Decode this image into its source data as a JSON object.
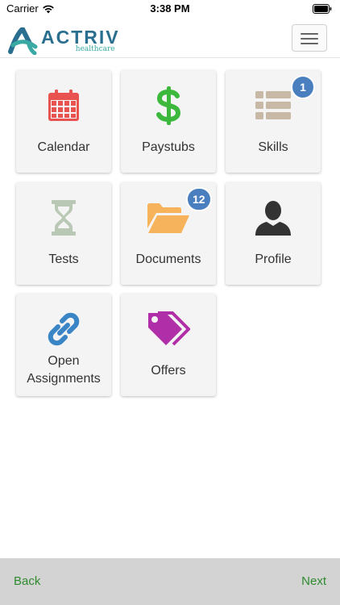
{
  "status": {
    "carrier": "Carrier",
    "time": "3:38 PM"
  },
  "brand": {
    "name": "ACTRIV",
    "sub": "healthcare"
  },
  "tiles": [
    {
      "label": "Calendar",
      "icon": "calendar-icon",
      "color": "#e8534f"
    },
    {
      "label": "Paystubs",
      "icon": "dollar-icon",
      "color": "#3cb83c"
    },
    {
      "label": "Skills",
      "icon": "list-icon",
      "color": "#c8b9a6",
      "badge": "1"
    },
    {
      "label": "Tests",
      "icon": "hourglass-icon",
      "color": "#b8c8b4"
    },
    {
      "label": "Documents",
      "icon": "folder-open-icon",
      "color": "#f7b35c",
      "badge": "12"
    },
    {
      "label": "Profile",
      "icon": "user-icon",
      "color": "#333333"
    },
    {
      "label_line1": "Open",
      "label_line2": "Assignments",
      "icon": "link-icon",
      "color": "#3a85c6"
    },
    {
      "label": "Offers",
      "icon": "tags-icon",
      "color": "#b02fa8"
    }
  ],
  "footer": {
    "back": "Back",
    "next": "Next"
  },
  "colors": {
    "badge": "#4a7fbf",
    "footer_bg": "#d3d3d3",
    "footer_text": "#2e8b2e",
    "brand": "#2a6f8f"
  }
}
